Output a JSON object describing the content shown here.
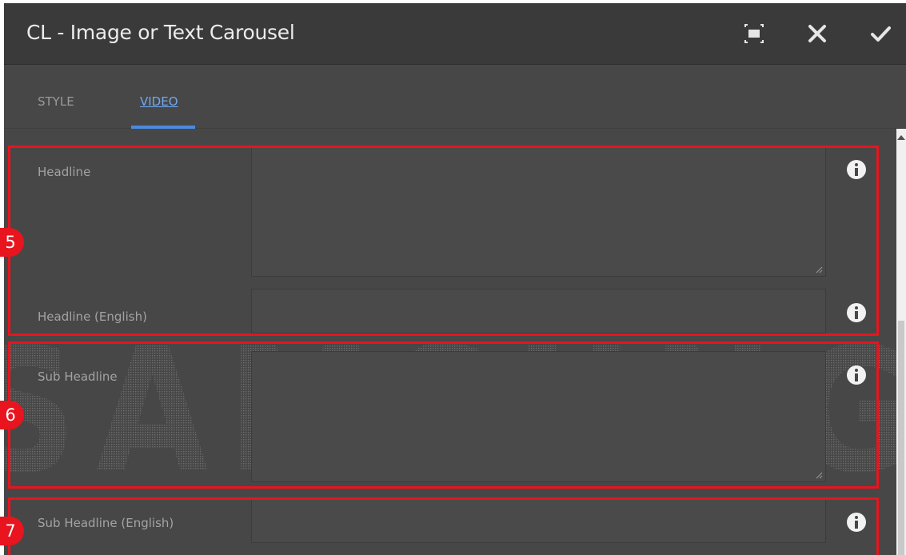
{
  "dialog": {
    "title": "CL - Image or Text Carousel",
    "icons": {
      "fullscreen": "fullscreen-icon",
      "close": "close-icon",
      "confirm": "check-icon"
    }
  },
  "tabs": [
    {
      "label": "STYLE",
      "active": false
    },
    {
      "label": "VIDEO",
      "active": true
    }
  ],
  "fields": [
    {
      "label": "Headline",
      "value": "",
      "type": "textarea"
    },
    {
      "label": "Headline (English)",
      "value": "",
      "type": "text"
    },
    {
      "label": "Sub Headline",
      "value": "",
      "type": "textarea"
    },
    {
      "label": "Sub Headline (English)",
      "value": "",
      "type": "text"
    }
  ],
  "annotations": [
    {
      "number": "5",
      "color": "#e8141e"
    },
    {
      "number": "6",
      "color": "#e8141e"
    },
    {
      "number": "7",
      "color": "#e8141e"
    }
  ],
  "watermark": "SAMSUNG",
  "colors": {
    "accent": "#4b8be0",
    "annotation_red": "#e8141e",
    "panel_bg": "#474747",
    "header_bg": "#3a3a3a"
  }
}
